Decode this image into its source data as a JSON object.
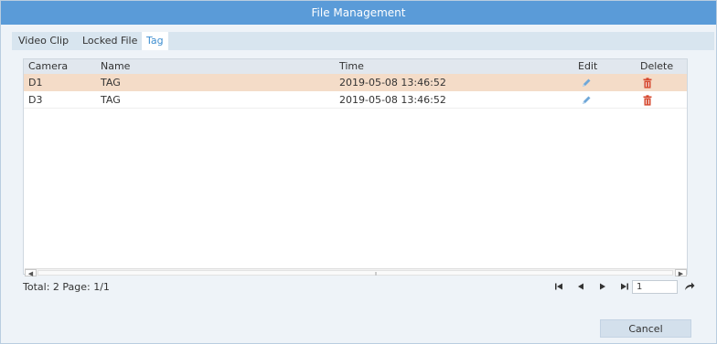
{
  "dialog": {
    "title": "File Management"
  },
  "tabs": [
    {
      "label": "Video Clip",
      "active": false
    },
    {
      "label": "Locked File",
      "active": false
    },
    {
      "label": "Tag",
      "active": true
    }
  ],
  "table": {
    "columns": [
      "Camera",
      "Name",
      "Time",
      "Edit",
      "Delete"
    ],
    "rows": [
      {
        "camera": "D1",
        "name": "TAG",
        "time": "2019-05-08 13:46:52",
        "selected": true
      },
      {
        "camera": "D3",
        "name": "TAG",
        "time": "2019-05-08 13:46:52",
        "selected": false
      }
    ]
  },
  "footer": {
    "total_text": "Total: 2  Page: 1/1",
    "page_input_value": "1"
  },
  "buttons": {
    "cancel": "Cancel"
  },
  "icons": {
    "edit": "pencil-icon",
    "delete": "trash-icon",
    "first": "first-page-icon",
    "prev": "prev-page-icon",
    "next": "next-page-icon",
    "last": "last-page-icon",
    "goto": "go-arrow-icon"
  },
  "colors": {
    "titlebar": "#5a9bd8",
    "selected_row": "#f4dcc8",
    "active_tab_text": "#3e8ed0",
    "edit_icon": "#6fa7d8",
    "delete_icon": "#d6492f"
  }
}
